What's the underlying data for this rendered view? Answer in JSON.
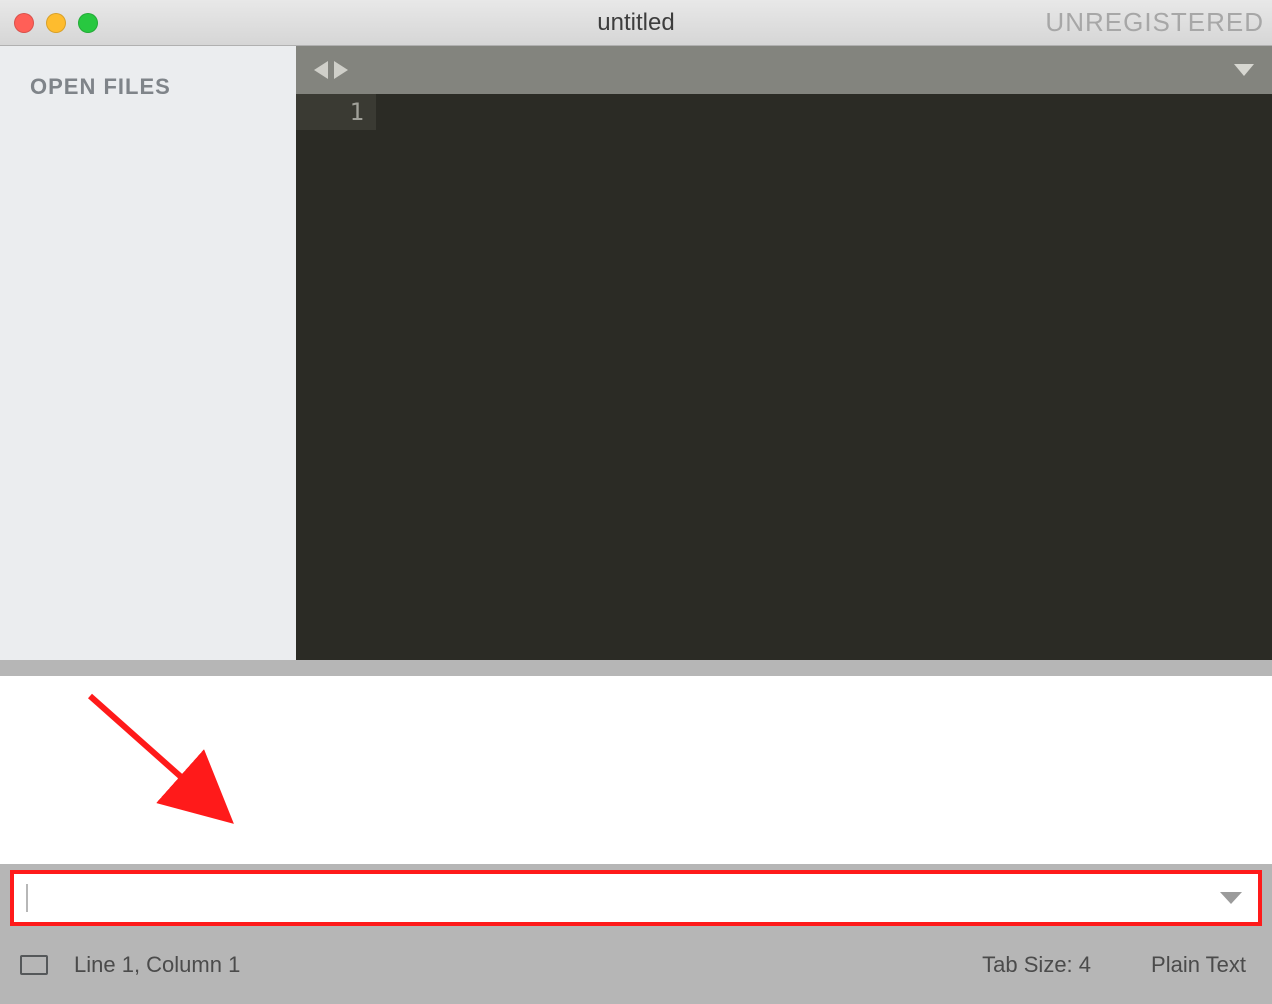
{
  "titlebar": {
    "title": "untitled",
    "registration": "UNREGISTERED"
  },
  "sidebar": {
    "header": "OPEN FILES"
  },
  "editor": {
    "gutter_line_1": "1"
  },
  "input": {
    "value": ""
  },
  "statusbar": {
    "position": "Line 1, Column 1",
    "tab_size": "Tab Size: 4",
    "language": "Plain Text"
  }
}
